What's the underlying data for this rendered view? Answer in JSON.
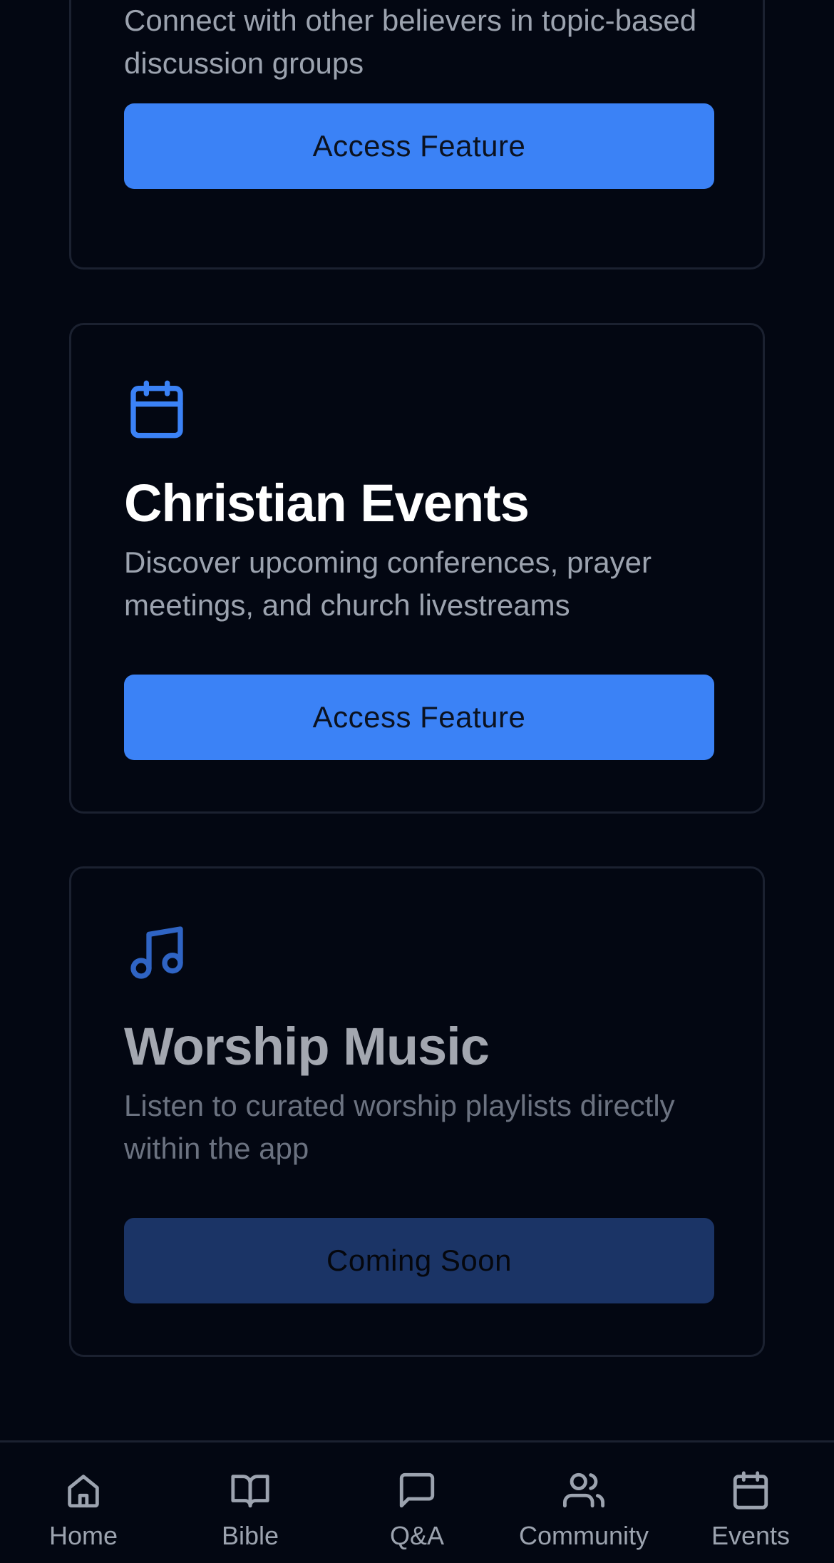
{
  "cards": [
    {
      "description": "Connect with other believers in topic-based discussion groups",
      "button_label": "Access Feature"
    },
    {
      "icon": "calendar-icon",
      "title": "Christian Events",
      "description": "Discover upcoming conferences, prayer meetings, and church livestreams",
      "button_label": "Access Feature"
    },
    {
      "icon": "music-note-icon",
      "title": "Worship Music",
      "description": "Listen to curated worship playlists directly within the app",
      "button_label": "Coming Soon"
    }
  ],
  "nav": {
    "items": [
      {
        "label": "Home",
        "icon": "home-icon"
      },
      {
        "label": "Bible",
        "icon": "book-icon"
      },
      {
        "label": "Q&A",
        "icon": "chat-bubble-icon"
      },
      {
        "label": "Community",
        "icon": "users-icon"
      },
      {
        "label": "Events",
        "icon": "calendar-icon"
      }
    ]
  },
  "colors": {
    "background": "#030712",
    "accent": "#3b82f6",
    "accent_disabled": "#1b3466",
    "text_primary": "#ffffff",
    "text_secondary": "#9ca3af"
  }
}
